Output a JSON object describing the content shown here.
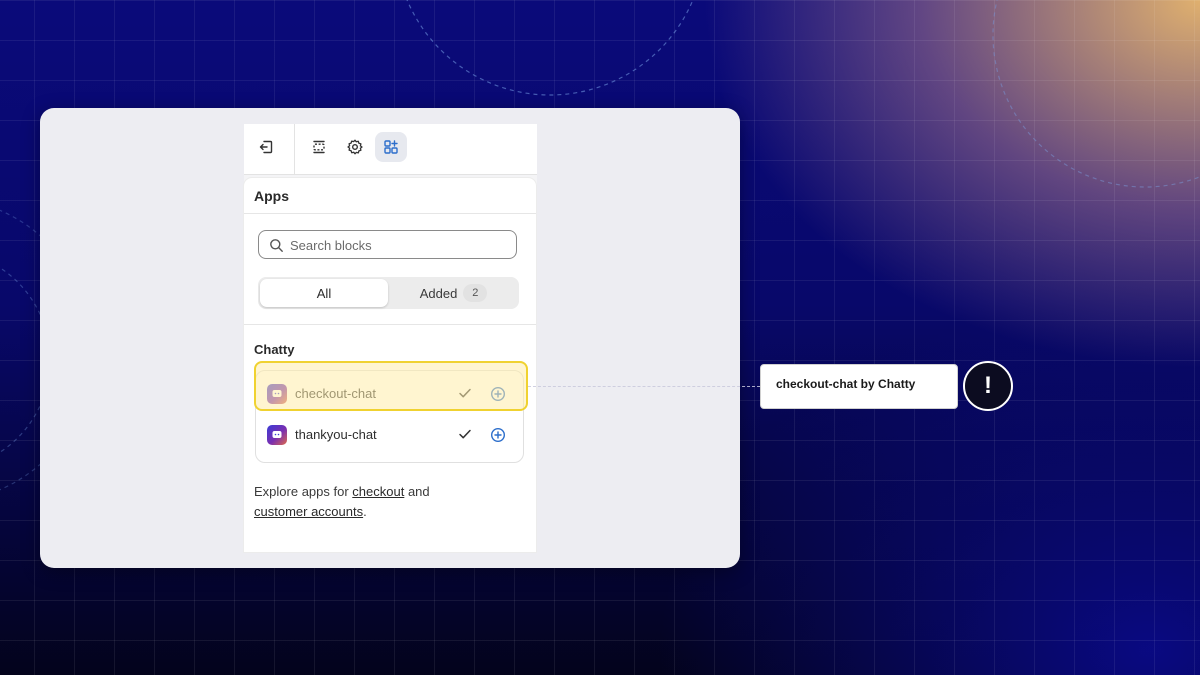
{
  "sheet": {
    "title": "Apps",
    "search_placeholder": "Search blocks",
    "tabs": {
      "all": "All",
      "added": "Added",
      "added_count": "2"
    },
    "group_title": "Chatty",
    "items": [
      {
        "label": "checkout-chat",
        "status": "added"
      },
      {
        "label": "thankyou-chat",
        "status": "added"
      }
    ],
    "explore": {
      "prefix": "Explore apps for ",
      "link1": "checkout",
      "middle": " and",
      "link2": "customer accounts",
      "suffix": "."
    }
  },
  "toolbar": {
    "icons": [
      "exit-icon",
      "sections-icon",
      "settings-icon",
      "apps-icon"
    ],
    "active": "apps-icon"
  },
  "callout": {
    "text": "checkout-chat by Chatty",
    "alert_symbol": "!"
  },
  "colors": {
    "highlight_border": "#f0d230",
    "accent_blue": "#2c6ecb"
  }
}
